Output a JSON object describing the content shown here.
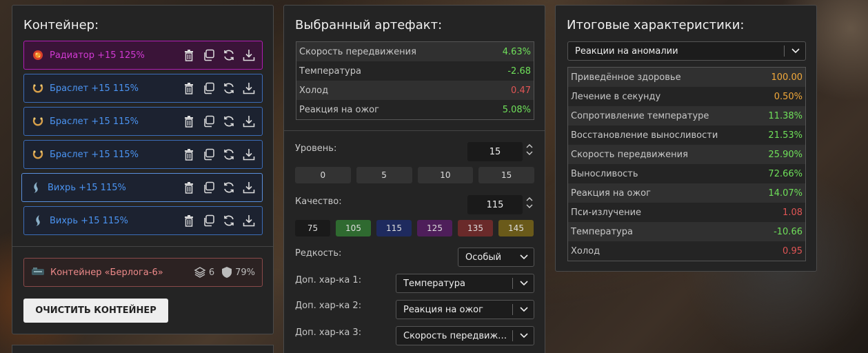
{
  "left": {
    "title": "Контейнер:",
    "artifacts": [
      {
        "label": "Радиатор +15 125%",
        "type": "radiator"
      },
      {
        "label": "Браслет +15 115%",
        "type": "bracelet"
      },
      {
        "label": "Браслет +15 115%",
        "type": "bracelet"
      },
      {
        "label": "Браслет +15 115%",
        "type": "bracelet"
      },
      {
        "label": "Вихрь +15 115%",
        "type": "whirl"
      },
      {
        "label": "Вихрь +15 115%",
        "type": "whirl"
      }
    ],
    "container": {
      "label": "Контейнер «Берлога-6»",
      "slots": "6",
      "protection": "79%"
    },
    "clear_button": "ОЧИСТИТЬ КОНТЕЙНЕР"
  },
  "middle": {
    "title": "Выбранный артефакт:",
    "stats": [
      {
        "name": "Скорость передвижения",
        "value": "4.63%",
        "color": "green"
      },
      {
        "name": "Температура",
        "value": "-2.68",
        "color": "green"
      },
      {
        "name": "Холод",
        "value": "0.47",
        "color": "red"
      },
      {
        "name": "Реакция на ожог",
        "value": "5.08%",
        "color": "green"
      }
    ],
    "level_label": "Уровень:",
    "level_value": "15",
    "level_presets": [
      "0",
      "5",
      "10",
      "15"
    ],
    "quality_label": "Качество:",
    "quality_value": "115",
    "quality_presets": [
      {
        "value": "75",
        "bg": "#1a1a1a"
      },
      {
        "value": "105",
        "bg": "#2f6a30"
      },
      {
        "value": "115",
        "bg": "#1e2a5e"
      },
      {
        "value": "125",
        "bg": "#4e1e5a"
      },
      {
        "value": "135",
        "bg": "#6a2a2a"
      },
      {
        "value": "145",
        "bg": "#6a5a1a"
      }
    ],
    "rarity_label": "Редкость:",
    "rarity_value": "Особый",
    "extra1_label": "Доп. хар-ка 1:",
    "extra1_value": "Температура",
    "extra2_label": "Доп. хар-ка 2:",
    "extra2_value": "Реакция на ожог",
    "extra3_label": "Доп. хар-ка 3:",
    "extra3_value": "Скорость передвижения"
  },
  "right": {
    "title": "Итоговые характеристики:",
    "filter_value": "Реакции на аномалии",
    "totals": [
      {
        "name": "Приведённое здоровье",
        "value": "100.00",
        "color": "orange"
      },
      {
        "name": "Лечение в секунду",
        "value": "0.50%",
        "color": "orange"
      },
      {
        "name": "Сопротивление температуре",
        "value": "11.38%",
        "color": "green"
      },
      {
        "name": "Восстановление выносливости",
        "value": "21.53%",
        "color": "green"
      },
      {
        "name": "Скорость передвижения",
        "value": "25.90%",
        "color": "green"
      },
      {
        "name": "Выносливость",
        "value": "72.66%",
        "color": "green"
      },
      {
        "name": "Реакция на ожог",
        "value": "14.07%",
        "color": "green"
      },
      {
        "name": "Пси-излучение",
        "value": "1.08",
        "color": "red"
      },
      {
        "name": "Температура",
        "value": "-10.66",
        "color": "green"
      },
      {
        "name": "Холод",
        "value": "0.95",
        "color": "red"
      }
    ]
  }
}
